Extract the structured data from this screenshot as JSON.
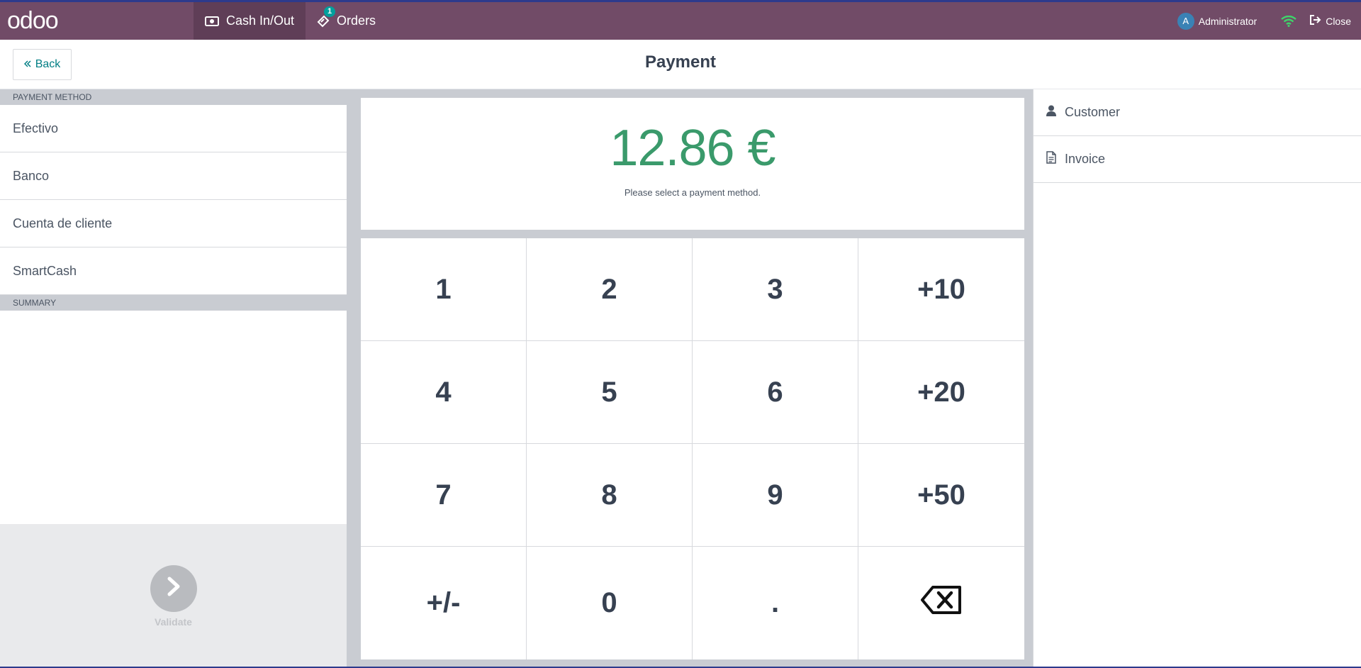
{
  "app": {
    "logo_text": "odoo",
    "brand_color": "#714b67",
    "accent_color": "#017e84"
  },
  "topbar": {
    "cash_in_out_label": "Cash In/Out",
    "orders_label": "Orders",
    "orders_badge": "1",
    "user_initial": "A",
    "user_name": "Administrator",
    "close_label": "Close"
  },
  "header": {
    "back_label": "Back",
    "title": "Payment"
  },
  "left": {
    "payment_method_title": "PAYMENT METHOD",
    "payment_methods": [
      "Efectivo",
      "Banco",
      "Cuenta de cliente",
      "SmartCash"
    ],
    "summary_title": "SUMMARY",
    "validate_label": "Validate"
  },
  "center": {
    "amount": "12.86 €",
    "amount_color": "#3a9a6b",
    "hint": "Please select a payment method.",
    "keys": [
      "1",
      "2",
      "3",
      "+10",
      "4",
      "5",
      "6",
      "+20",
      "7",
      "8",
      "9",
      "+50",
      "+/-",
      "0",
      ".",
      "backspace-icon"
    ]
  },
  "right": {
    "customer_label": "Customer",
    "invoice_label": "Invoice"
  }
}
